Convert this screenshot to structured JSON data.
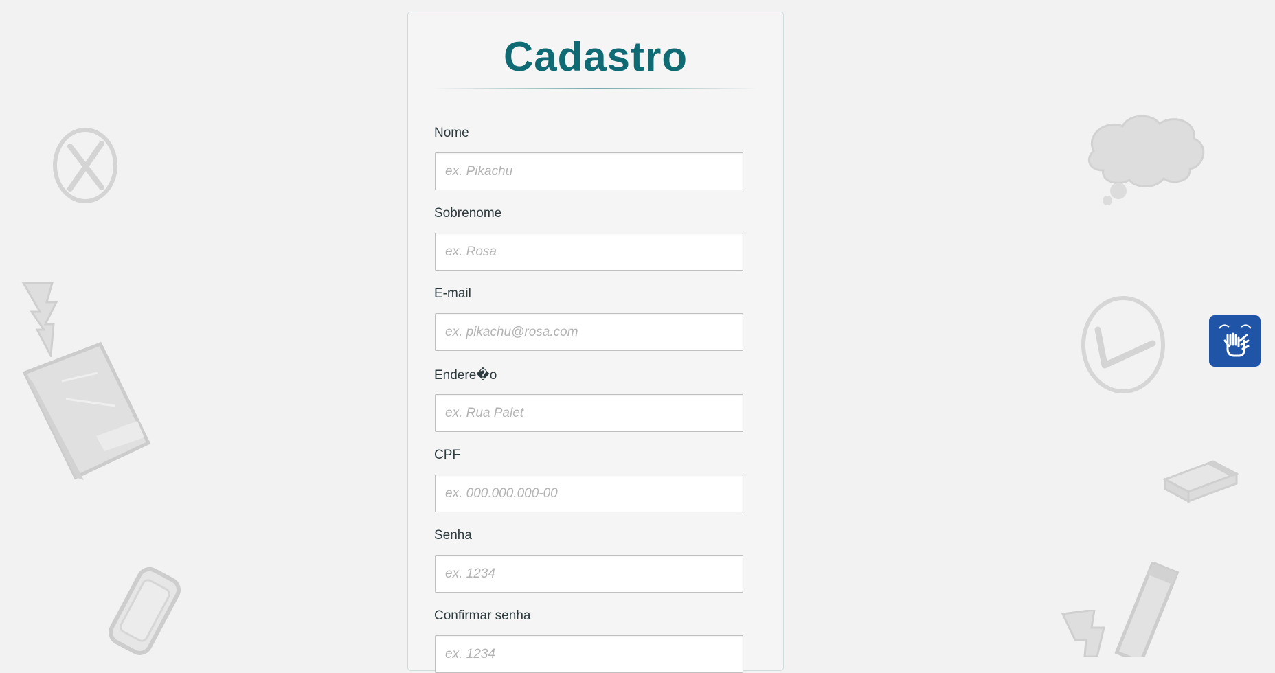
{
  "form": {
    "title": "Cadastro",
    "fields": [
      {
        "label": "Nome",
        "placeholder": "ex. Pikachu",
        "value": ""
      },
      {
        "label": "Sobrenome",
        "placeholder": "ex. Rosa",
        "value": ""
      },
      {
        "label": "E-mail",
        "placeholder": "ex. pikachu@rosa.com",
        "value": ""
      },
      {
        "label": "Endere�o",
        "placeholder": "ex. Rua Palet",
        "value": ""
      },
      {
        "label": "CPF",
        "placeholder": "ex. 000.000.000-00",
        "value": ""
      },
      {
        "label": "Senha",
        "placeholder": "ex. 1234",
        "value": ""
      },
      {
        "label": "Confirmar senha",
        "placeholder": "ex. 1234",
        "value": ""
      }
    ]
  },
  "accessibility": {
    "icon": "sign-language-hands-icon",
    "color": "#1f54a6"
  },
  "background": {
    "color": "#f2f2f2",
    "icons": [
      "circled-x-icon",
      "lightning-icon",
      "book-icon",
      "phone-icon",
      "thought-cloud-icon",
      "circled-check-icon",
      "eraser-icon",
      "pencil-icon"
    ]
  },
  "colors": {
    "title": "#0f6a73",
    "label": "#2d3b3f",
    "placeholder": "#b3b3b3"
  }
}
